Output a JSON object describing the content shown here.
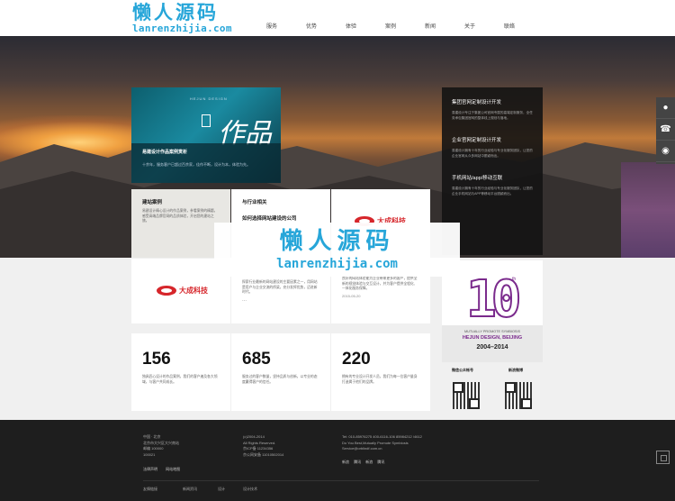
{
  "header": {
    "logo_cn": "懒人源码",
    "logo_en": "lanrenzhijia.com",
    "nav": [
      "服务",
      "优势",
      "体验",
      "案例",
      "新闻",
      "关于",
      "联络"
    ]
  },
  "feature": {
    "small_text": "HEJUN DESIGN",
    "big_text": "作品",
    "title": "易建设计作品案例赏析",
    "desc": "十余年，服务客户已超过百余家，佳作不断，设计为本，体验为先。"
  },
  "right_panel": [
    {
      "title": "集团官网定制设计开发",
      "desc": "易建设计专注于集团公司官网专属的高端定制服务，全任务承包集团官网的整体线上规划与落地。"
    },
    {
      "title": "企业官网定制设计开发",
      "desc": "易建设计拥有十年的行业经验与专业化服务团队，让您的企业官网从众多网站中脱颖而出。"
    },
    {
      "title": "手机网站/app/移动互联",
      "desc": "易建设计拥有十年的行业经验与专业化服务团队，让您的企业手机网站与APP等移动平台脱颖而出。"
    }
  ],
  "tiles": {
    "t1_title": "建站案例",
    "t1_desc": "易建设计精心设计的作品案例，参看案例的精髓，感受高端品牌官网的品质体验，开启您的建站之旅。",
    "t2_title": "与行业相关",
    "t2_sub": "如何选择网站建设的公司",
    "t3_brand": "大成科技",
    "t4_brand": "大成科技",
    "t5_desc": "探索行业最新的网站建设的主要因素之一，用网站是用户与企业交流的桥梁，充分发挥优势，迈进新时代。",
    "t5_dots": "...",
    "t6_desc": "良好的网站体验能为企业带来更多的客户，提供全新的视觉体验与交互设计，并为客户提供全程化、一体化服务保障。",
    "t6_date": "2015-05-20"
  },
  "watermark": {
    "cn": "懒人源码",
    "en": "lanrenzhijia.com"
  },
  "stats": [
    {
      "num": "156",
      "desc": "独具匠心设计的作品案例，我们的客户遍及各大领域，与客户共同成长。"
    },
    {
      "num": "685",
      "desc": "服务过的客户数量，坚持品质与创新，以专业的态度赢得客户的信任。"
    },
    {
      "num": "220",
      "desc": "拥有的专业设计开发人员，我们为每一位客户量身打造属于他们的品牌。"
    }
  ],
  "anniv": {
    "num": "10",
    "sup": "th",
    "slogan": "MUTUALLY PROMOTE SYMBIOSIS",
    "company": "HEJUN DESIGN, BEIJING",
    "years": "2004–2014",
    "qr1_label": "微信公众帐号",
    "qr2_label": "新浪微博"
  },
  "footer": {
    "col1": [
      "中国 · 北京",
      "北京市大兴区大兴南站",
      "邮编 100000",
      "100021"
    ],
    "col2": [
      "(c)2004-2014",
      "All Rights Reserved.",
      "京ICP备 11234356",
      "京公网安备 11010502014"
    ],
    "col3": [
      "Tel: 010-85976275 400-6116-106 85984212 /4612",
      "Do You Best,Mutually Promote Symbiosis",
      "Service@orblindf.com.cn"
    ],
    "links": [
      "法律声明",
      "网站地图"
    ],
    "social": [
      "新浪",
      "腾讯",
      "新浪",
      "腾讯"
    ],
    "bottom": [
      "友情链接",
      "新闻资讯",
      "设计",
      "设计技术"
    ]
  }
}
